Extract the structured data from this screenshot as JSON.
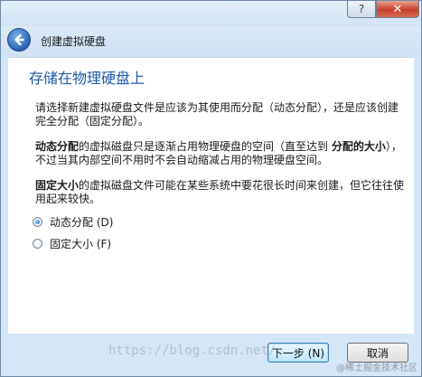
{
  "window": {
    "help_label": "?",
    "close_label": "✕"
  },
  "header": {
    "back_icon": "back-arrow-icon",
    "title": "创建虚拟硬盘"
  },
  "page": {
    "title": "存储在物理硬盘上",
    "intro": "请选择新建虚拟硬盘文件是应该为其使用而分配（动态分配），还是应该创建完全分配（固定分配）。",
    "dynamic_desc_bold1": "动态分配",
    "dynamic_desc_part1": "的虚拟磁盘只是逐渐占用物理硬盘的空间（直至达到 ",
    "dynamic_desc_bold2": "分配的大小",
    "dynamic_desc_part2": "），不过当其内部空间不用时不会自动缩减占用的物理硬盘空间。",
    "fixed_desc_bold": "固定大小",
    "fixed_desc_rest": "的虚拟磁盘文件可能在某些系统中要花很长时间来创建，但它往往使用起来较快。"
  },
  "options": [
    {
      "label": "动态分配 (D)",
      "checked": true
    },
    {
      "label": "固定大小 (F)",
      "checked": false
    }
  ],
  "footer": {
    "next_label": "下一步 (N)",
    "cancel_label": "取消"
  },
  "watermark": {
    "text": "https://blog.csdn.net/",
    "brand": "@稀土掘金技术社区"
  }
}
